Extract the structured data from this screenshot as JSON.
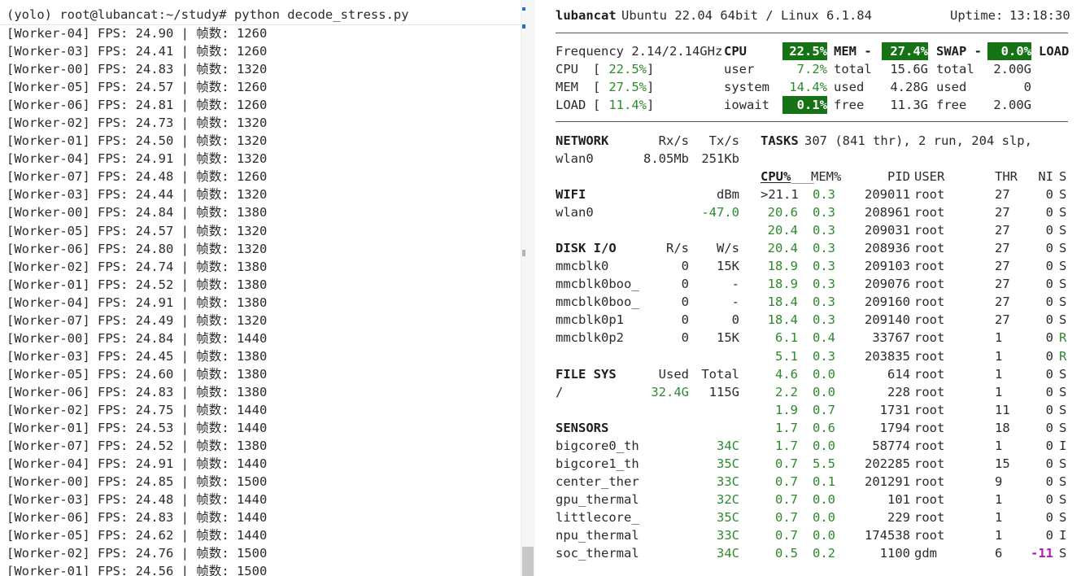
{
  "terminal": {
    "prompt": "(yolo) root@lubancat:~/study# python decode_stress.py",
    "lines": [
      "[Worker-04] FPS: 24.90 | 帧数: 1260",
      "[Worker-03] FPS: 24.41 | 帧数: 1260",
      "[Worker-00] FPS: 24.83 | 帧数: 1320",
      "[Worker-05] FPS: 24.57 | 帧数: 1260",
      "[Worker-06] FPS: 24.81 | 帧数: 1260",
      "[Worker-02] FPS: 24.73 | 帧数: 1320",
      "[Worker-01] FPS: 24.50 | 帧数: 1320",
      "[Worker-04] FPS: 24.91 | 帧数: 1320",
      "[Worker-07] FPS: 24.48 | 帧数: 1260",
      "[Worker-03] FPS: 24.44 | 帧数: 1320",
      "[Worker-00] FPS: 24.84 | 帧数: 1380",
      "[Worker-05] FPS: 24.57 | 帧数: 1320",
      "[Worker-06] FPS: 24.80 | 帧数: 1320",
      "[Worker-02] FPS: 24.74 | 帧数: 1380",
      "[Worker-01] FPS: 24.52 | 帧数: 1380",
      "[Worker-04] FPS: 24.91 | 帧数: 1380",
      "[Worker-07] FPS: 24.49 | 帧数: 1320",
      "[Worker-00] FPS: 24.84 | 帧数: 1440",
      "[Worker-03] FPS: 24.45 | 帧数: 1380",
      "[Worker-05] FPS: 24.60 | 帧数: 1380",
      "[Worker-06] FPS: 24.83 | 帧数: 1380",
      "[Worker-02] FPS: 24.75 | 帧数: 1440",
      "[Worker-01] FPS: 24.53 | 帧数: 1440",
      "[Worker-07] FPS: 24.52 | 帧数: 1380",
      "[Worker-04] FPS: 24.91 | 帧数: 1440",
      "[Worker-00] FPS: 24.85 | 帧数: 1500",
      "[Worker-03] FPS: 24.48 | 帧数: 1440",
      "[Worker-06] FPS: 24.83 | 帧数: 1440",
      "[Worker-05] FPS: 24.62 | 帧数: 1440",
      "[Worker-02] FPS: 24.76 | 帧数: 1500",
      "[Worker-01] FPS: 24.56 | 帧数: 1500"
    ]
  },
  "header": {
    "hostname": "lubancat",
    "os": "Ubuntu 22.04 64bit / Linux 6.1.84",
    "uptime_label": "Uptime:",
    "uptime": "13:18:30"
  },
  "summary": {
    "frequency": "Frequency 2.14/2.14GHz",
    "cpu_label": "CPU",
    "cpu_pct": "22.5%",
    "mem_label": "MEM -",
    "mem_pct": "27.4%",
    "swap_label": "SWAP -",
    "swap_pct": "0.0%",
    "load_label": "LOAD",
    "bars": [
      {
        "label": "CPU",
        "open": "[",
        "value": "22.5%",
        "close": "]"
      },
      {
        "label": "MEM",
        "open": "[",
        "value": "27.5%",
        "close": "]"
      },
      {
        "label": "LOAD",
        "open": "[",
        "value": "11.4%",
        "close": "]"
      }
    ],
    "cpu_detail": [
      {
        "k": "user",
        "v": "7.2%"
      },
      {
        "k": "system",
        "v": "14.4%"
      },
      {
        "k": "iowait",
        "v": "0.1%"
      }
    ],
    "mem_detail": [
      {
        "k": "total",
        "v": "15.6G"
      },
      {
        "k": "used",
        "v": "4.28G"
      },
      {
        "k": "free",
        "v": "11.3G"
      }
    ],
    "swap_detail": [
      {
        "k": "total",
        "v": "2.00G"
      },
      {
        "k": "used",
        "v": "0"
      },
      {
        "k": "free",
        "v": "2.00G"
      }
    ]
  },
  "network": {
    "title": "NETWORK",
    "rx_label": "Rx/s",
    "tx_label": "Tx/s",
    "iface": "wlan0",
    "rx": "8.05Mb",
    "tx": "251Kb"
  },
  "wifi": {
    "title": "WIFI",
    "unit": "dBm",
    "iface": "wlan0",
    "value": "-47.0"
  },
  "disk": {
    "title": "DISK I/O",
    "r_label": "R/s",
    "w_label": "W/s",
    "rows": [
      {
        "name": "mmcblk0",
        "r": "0",
        "w": "15K"
      },
      {
        "name": "mmcblk0boo_",
        "r": "0",
        "w": "-"
      },
      {
        "name": "mmcblk0boo_",
        "r": "0",
        "w": "-"
      },
      {
        "name": "mmcblk0p1",
        "r": "0",
        "w": "0"
      },
      {
        "name": "mmcblk0p2",
        "r": "0",
        "w": "15K"
      }
    ]
  },
  "filesys": {
    "title": "FILE SYS",
    "used_label": "Used",
    "total_label": "Total",
    "mount": "/",
    "used": "32.4G",
    "total": "115G"
  },
  "sensors": {
    "title": "SENSORS",
    "rows": [
      {
        "name": "bigcore0_th",
        "v": "34C"
      },
      {
        "name": "bigcore1_th",
        "v": "35C"
      },
      {
        "name": "center_ther",
        "v": "33C"
      },
      {
        "name": "gpu_thermal",
        "v": "32C"
      },
      {
        "name": "littlecore_",
        "v": "35C"
      },
      {
        "name": "npu_thermal",
        "v": "33C"
      },
      {
        "name": "soc_thermal",
        "v": "34C"
      }
    ]
  },
  "tasks": {
    "title": "TASKS",
    "summary": "307 (841 thr), 2 run, 204 slp,",
    "columns": {
      "cpu": "CPU%",
      "mem": "MEM%",
      "pid": "PID",
      "user": "USER",
      "thr": "THR",
      "ni": "NI",
      "s": "S"
    },
    "rows": [
      {
        "cpu": ">21.1",
        "mem": "0.3",
        "pid": "209011",
        "user": "root",
        "thr": "27",
        "ni": "0",
        "s": "S"
      },
      {
        "cpu": "20.6",
        "mem": "0.3",
        "pid": "208961",
        "user": "root",
        "thr": "27",
        "ni": "0",
        "s": "S"
      },
      {
        "cpu": "20.4",
        "mem": "0.3",
        "pid": "209031",
        "user": "root",
        "thr": "27",
        "ni": "0",
        "s": "S"
      },
      {
        "cpu": "20.4",
        "mem": "0.3",
        "pid": "208936",
        "user": "root",
        "thr": "27",
        "ni": "0",
        "s": "S"
      },
      {
        "cpu": "18.9",
        "mem": "0.3",
        "pid": "209103",
        "user": "root",
        "thr": "27",
        "ni": "0",
        "s": "S"
      },
      {
        "cpu": "18.9",
        "mem": "0.3",
        "pid": "209076",
        "user": "root",
        "thr": "27",
        "ni": "0",
        "s": "S"
      },
      {
        "cpu": "18.4",
        "mem": "0.3",
        "pid": "209160",
        "user": "root",
        "thr": "27",
        "ni": "0",
        "s": "S"
      },
      {
        "cpu": "18.4",
        "mem": "0.3",
        "pid": "209140",
        "user": "root",
        "thr": "27",
        "ni": "0",
        "s": "S"
      },
      {
        "cpu": "6.1",
        "mem": "0.4",
        "pid": "33767",
        "user": "root",
        "thr": "1",
        "ni": "0",
        "s": "R"
      },
      {
        "cpu": "5.1",
        "mem": "0.3",
        "pid": "203835",
        "user": "root",
        "thr": "1",
        "ni": "0",
        "s": "R"
      },
      {
        "cpu": "4.6",
        "mem": "0.0",
        "pid": "614",
        "user": "root",
        "thr": "1",
        "ni": "0",
        "s": "S"
      },
      {
        "cpu": "2.2",
        "mem": "0.0",
        "pid": "228",
        "user": "root",
        "thr": "1",
        "ni": "0",
        "s": "S"
      },
      {
        "cpu": "1.9",
        "mem": "0.7",
        "pid": "1731",
        "user": "root",
        "thr": "11",
        "ni": "0",
        "s": "S"
      },
      {
        "cpu": "1.7",
        "mem": "0.6",
        "pid": "1794",
        "user": "root",
        "thr": "18",
        "ni": "0",
        "s": "S"
      },
      {
        "cpu": "1.7",
        "mem": "0.0",
        "pid": "58774",
        "user": "root",
        "thr": "1",
        "ni": "0",
        "s": "I"
      },
      {
        "cpu": "0.7",
        "mem": "5.5",
        "pid": "202285",
        "user": "root",
        "thr": "15",
        "ni": "0",
        "s": "S"
      },
      {
        "cpu": "0.7",
        "mem": "0.1",
        "pid": "201291",
        "user": "root",
        "thr": "9",
        "ni": "0",
        "s": "S"
      },
      {
        "cpu": "0.7",
        "mem": "0.0",
        "pid": "101",
        "user": "root",
        "thr": "1",
        "ni": "0",
        "s": "S"
      },
      {
        "cpu": "0.7",
        "mem": "0.0",
        "pid": "229",
        "user": "root",
        "thr": "1",
        "ni": "0",
        "s": "S"
      },
      {
        "cpu": "0.7",
        "mem": "0.0",
        "pid": "174538",
        "user": "root",
        "thr": "1",
        "ni": "0",
        "s": "I"
      },
      {
        "cpu": "0.5",
        "mem": "0.2",
        "pid": "1100",
        "user": "gdm",
        "thr": "6",
        "ni": "-11",
        "s": "S"
      }
    ]
  },
  "colors": {
    "accent_green": "#157315",
    "value_green": "#2d8a2d",
    "nice_negative": "#b01cb0"
  }
}
